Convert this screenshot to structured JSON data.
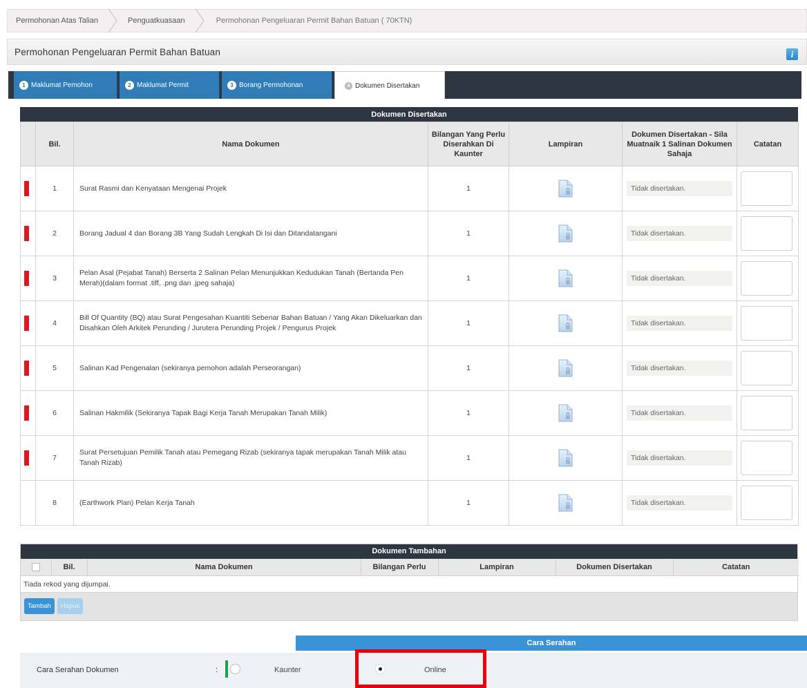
{
  "breadcrumb": [
    "Permohonan Atas Talian",
    "Penguatkuasaan",
    "Permohonan Pengeluaran Permit Bahan Batuan ( 70KTN)"
  ],
  "page_title": "Permohonan Pengeluaran Permit Bahan Batuan",
  "info_icon": "i",
  "tabs": [
    {
      "num": "1",
      "label": "Maklumat Pemohon"
    },
    {
      "num": "2",
      "label": "Maklumat Permit"
    },
    {
      "num": "3",
      "label": "Borang Permohonan"
    },
    {
      "num": "4",
      "label": "Dokumen Disertakan"
    }
  ],
  "documents": {
    "title": "Dokumen Disertakan",
    "headers": {
      "bil": "Bil.",
      "nama": "Nama Dokumen",
      "qty": "Bilangan Yang Perlu Diserahkan Di Kaunter",
      "lampiran": "Lampiran",
      "disertakan": "Dokumen Disertakan - Sila Muatnaik 1 Salinan Dokumen Sahaja",
      "catatan": "Catatan"
    },
    "rows": [
      {
        "bil": "1",
        "nama": "Surat Rasmi dan Kenyataan Mengenai Projek",
        "qty": "1",
        "status": "Tidak disertakan.",
        "required": true
      },
      {
        "bil": "2",
        "nama": "Borang Jadual 4 dan Borang 3B Yang Sudah Lengkah Di Isi dan Ditandatangani",
        "qty": "1",
        "status": "Tidak disertakan.",
        "required": true
      },
      {
        "bil": "3",
        "nama": "Pelan Asal (Pejabat Tanah) Berserta 2 Salinan Pelan Menunjukkan Kedudukan Tanah (Bertanda Pen Merah)(dalam format .tiff, .png dan .jpeg sahaja)",
        "qty": "1",
        "status": "Tidak disertakan.",
        "required": true
      },
      {
        "bil": "4",
        "nama": "Bill Of Quantity (BQ) atau Surat Pengesahan Kuantiti Sebenar Bahan Batuan / Yang Akan Dikeluarkan dan Disahkan Oleh Arkitek Perunding / Jurutera Perunding Projek / Pengurus Projek",
        "qty": "1",
        "status": "Tidak disertakan.",
        "required": true
      },
      {
        "bil": "5",
        "nama": "Salinan Kad Pengenalan (sekiranya pemohon adalah Perseorangan)",
        "qty": "1",
        "status": "Tidak disertakan.",
        "required": true
      },
      {
        "bil": "6",
        "nama": "Salinan Hakmilik (Sekiranya Tapak Bagi Kerja Tanah Merupakan Tanah Milik)",
        "qty": "1",
        "status": "Tidak disertakan.",
        "required": true
      },
      {
        "bil": "7",
        "nama": "Surat Persetujuan Pemilik Tanah atau Pemegang Rizab (sekiranya tapak merupakan Tanah Milik atau Tanah Rizab)",
        "qty": "1",
        "status": "Tidak disertakan.",
        "required": true
      },
      {
        "bil": "8",
        "nama": "(Earthwork Plan) Pelan Kerja Tanah",
        "qty": "1",
        "status": "Tidak disertakan.",
        "required": false
      }
    ]
  },
  "extra": {
    "title": "Dokumen Tambahan",
    "headers": {
      "bil": "Bil.",
      "nama": "Nama Dokumen",
      "bilangan": "Bilangan Perlu",
      "lampiran": "Lampiran",
      "disertakan": "Dokumen Disertakan",
      "catatan": "Catatan"
    },
    "empty": "Tiada rekod yang dijumpai.",
    "add_label": "Tambah",
    "delete_label": "Hapus"
  },
  "cara_serahan": {
    "title": "Cara Serahan",
    "label": "Cara Serahan Dokumen",
    "colon": ":",
    "options": [
      "Kaunter",
      "Online"
    ],
    "selected": "Online"
  },
  "colors": {
    "accent": "#3b93d6",
    "header_dark": "#2e3641",
    "required": "#e0141e",
    "highlight": "#e8000d"
  }
}
